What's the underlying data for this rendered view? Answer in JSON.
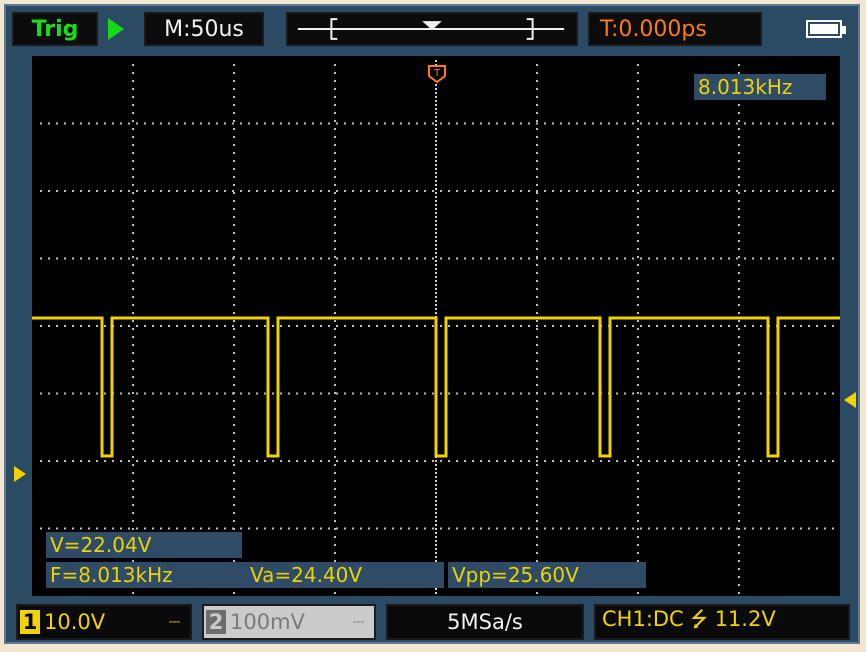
{
  "top": {
    "trig_label": "Trig",
    "timebase": "M:50us",
    "trigger_offset": "T:0.000ps"
  },
  "screen": {
    "frequency": "8.013kHz",
    "measurements": {
      "v": "V=22.04V",
      "f": "F=8.013kHz",
      "va": "Va=24.40V",
      "vpp": "Vpp=25.60V"
    }
  },
  "bottom": {
    "ch1_number": "1",
    "ch1_volts": "10.0V",
    "ch2_number": "2",
    "ch2_volts": "100mV",
    "coupling_symbol": "⎓",
    "sample_rate": "5MSa/s",
    "trigger_setting": "CH1:DC ⭍ 11.2V"
  },
  "colors": {
    "trace": "#f2d200",
    "trigger": "#ff7a14",
    "screen_bg": "#000000",
    "panel_bg": "#2b4b64",
    "trig_green": "#13e01b"
  },
  "icons": [
    "run-play-icon",
    "battery-icon",
    "trigger-marker-icon",
    "channel1-level-marker-icon",
    "trigger-level-marker-icon"
  ]
}
